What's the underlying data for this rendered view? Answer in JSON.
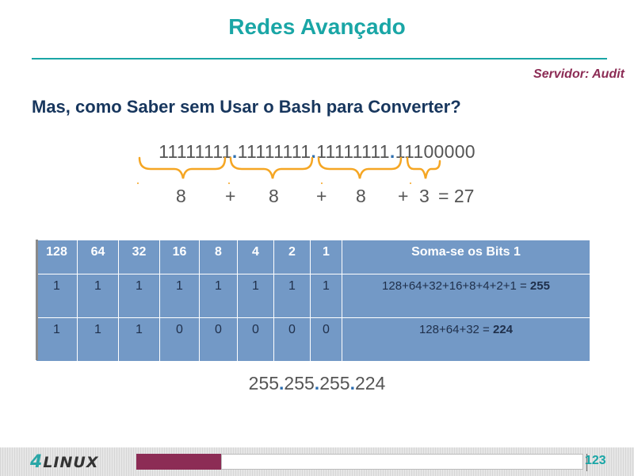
{
  "title": "Redes Avançado",
  "subtitle": "Servidor: Audit",
  "heading": "Mas, como Saber sem Usar o Bash para Converter?",
  "binary": {
    "octets": [
      "11111111",
      "11111111",
      "11111111",
      "11100000"
    ],
    "separator": "."
  },
  "sums": {
    "values": [
      "8",
      "8",
      "8",
      "3"
    ],
    "plus": "+",
    "result": "= 27"
  },
  "table": {
    "headers": [
      "128",
      "64",
      "32",
      "16",
      "8",
      "4",
      "2",
      "1",
      "Soma-se os Bits 1"
    ],
    "rows": [
      {
        "bits": [
          "1",
          "1",
          "1",
          "1",
          "1",
          "1",
          "1",
          "1"
        ],
        "sum_text": "128+64+32+16+8+4+2+1 = ",
        "sum_bold": "255"
      },
      {
        "bits": [
          "1",
          "1",
          "1",
          "0",
          "0",
          "0",
          "0",
          "0"
        ],
        "sum_text": "128+64+32 = ",
        "sum_bold": "224"
      }
    ]
  },
  "ip": {
    "octets": [
      "255",
      "255",
      "255",
      "224"
    ],
    "separator": "."
  },
  "footer": {
    "logo_number": "4",
    "logo_text": "LINUX",
    "page_number": "123",
    "progress": 0.19
  },
  "colors": {
    "accent": "#1aa6a6",
    "subtitle": "#8c2c55",
    "heading": "#17365d",
    "table_bg": "#7399c6",
    "brace": "#f5a623",
    "dot": "#2e6fb0"
  }
}
